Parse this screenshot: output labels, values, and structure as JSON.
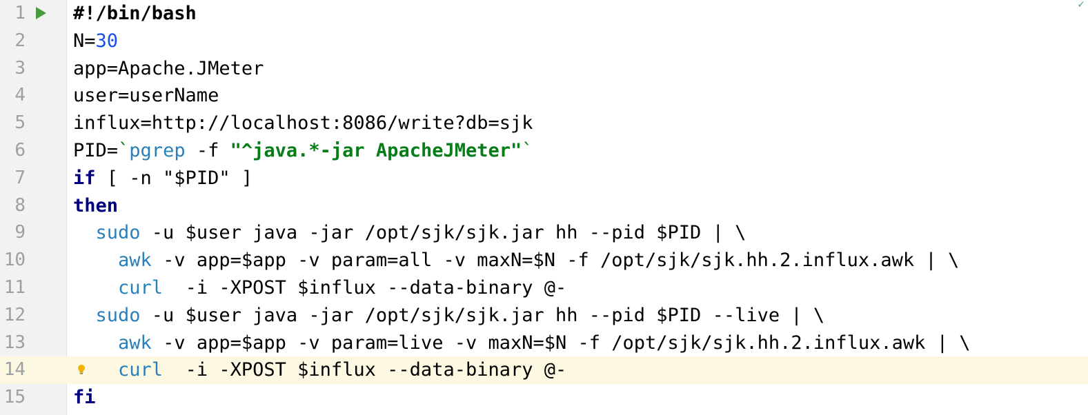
{
  "editor": {
    "status_icon": "check-icon",
    "current_line": 14,
    "colors": {
      "gutter_bg": "#f2f2f2",
      "current_line_bg": "#fdf8e2",
      "line_number": "#9aa0a6",
      "keyword": "#000080",
      "command": "#2a7fb8",
      "string": "#067d17",
      "number": "#1750eb",
      "run_icon": "#4a9a3f"
    },
    "lines": [
      {
        "num": "1",
        "run_icon": true,
        "tokens": [
          {
            "t": "shebang",
            "v": "#!/bin/bash"
          }
        ]
      },
      {
        "num": "2",
        "tokens": [
          {
            "t": "plain",
            "v": "N="
          },
          {
            "t": "num",
            "v": "30"
          }
        ]
      },
      {
        "num": "3",
        "tokens": [
          {
            "t": "plain",
            "v": "app=Apache.JMeter"
          }
        ]
      },
      {
        "num": "4",
        "tokens": [
          {
            "t": "plain",
            "v": "user=userName"
          }
        ]
      },
      {
        "num": "5",
        "tokens": [
          {
            "t": "plain",
            "v": "influx=http://localhost:8086/write?db=sjk"
          }
        ]
      },
      {
        "num": "6",
        "tokens": [
          {
            "t": "plain",
            "v": "PID="
          },
          {
            "t": "tick",
            "v": "`"
          },
          {
            "t": "cmd",
            "v": "pgrep"
          },
          {
            "t": "plain",
            "v": " -f "
          },
          {
            "t": "str",
            "v": "\"^java.*-jar ApacheJMeter\""
          },
          {
            "t": "tick",
            "v": "`"
          }
        ]
      },
      {
        "num": "7",
        "tokens": [
          {
            "t": "kw",
            "v": "if"
          },
          {
            "t": "plain",
            "v": " [ -n \"$PID\" ]"
          }
        ]
      },
      {
        "num": "8",
        "tokens": [
          {
            "t": "kw",
            "v": "then"
          }
        ]
      },
      {
        "num": "9",
        "tokens": [
          {
            "t": "plain",
            "v": "  "
          },
          {
            "t": "cmd",
            "v": "sudo"
          },
          {
            "t": "plain",
            "v": " -u $user java -jar /opt/sjk/sjk.jar hh --pid $PID | \\"
          }
        ]
      },
      {
        "num": "10",
        "tokens": [
          {
            "t": "plain",
            "v": "    "
          },
          {
            "t": "cmd",
            "v": "awk"
          },
          {
            "t": "plain",
            "v": " -v app=$app -v param=all -v maxN=$N -f /opt/sjk/sjk.hh.2.influx.awk | \\"
          }
        ]
      },
      {
        "num": "11",
        "tokens": [
          {
            "t": "plain",
            "v": "    "
          },
          {
            "t": "cmd",
            "v": "curl"
          },
          {
            "t": "plain",
            "v": "  -i -XPOST $influx --data-binary @-"
          }
        ]
      },
      {
        "num": "12",
        "tokens": [
          {
            "t": "plain",
            "v": "  "
          },
          {
            "t": "cmd",
            "v": "sudo"
          },
          {
            "t": "plain",
            "v": " -u $user java -jar /opt/sjk/sjk.jar hh --pid $PID --live | \\"
          }
        ]
      },
      {
        "num": "13",
        "tokens": [
          {
            "t": "plain",
            "v": "    "
          },
          {
            "t": "cmd",
            "v": "awk"
          },
          {
            "t": "plain",
            "v": " -v app=$app -v param=live -v maxN=$N -f /opt/sjk/sjk.hh.2.influx.awk | \\"
          }
        ]
      },
      {
        "num": "14",
        "bulb_icon": true,
        "tokens": [
          {
            "t": "plain",
            "v": "    "
          },
          {
            "t": "cmd",
            "v": "curl"
          },
          {
            "t": "plain",
            "v": "  -i -XPOST $influx --data-binary @-"
          }
        ]
      },
      {
        "num": "15",
        "tokens": [
          {
            "t": "kw",
            "v": "fi"
          }
        ]
      }
    ]
  }
}
